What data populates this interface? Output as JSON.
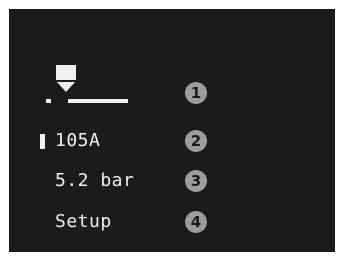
{
  "screen": {
    "background_color": "#1b1b1b",
    "text_color": "#f0f0f0",
    "callout_color": "#9c9c9c"
  },
  "menu": {
    "items": [
      {
        "icon": "torch-height-icon",
        "callout": "1"
      },
      {
        "label": "105A",
        "selected": true,
        "callout": "2"
      },
      {
        "label": "5.2 bar",
        "callout": "3"
      },
      {
        "label": "Setup",
        "callout": "4"
      }
    ]
  }
}
